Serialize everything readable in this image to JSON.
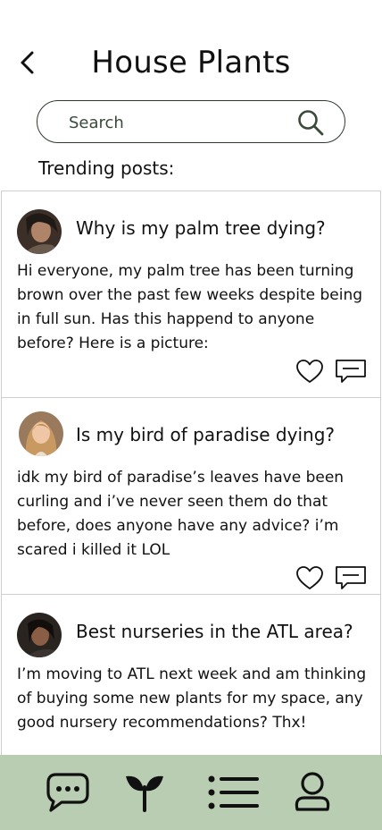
{
  "header": {
    "title": "House Plants"
  },
  "search": {
    "placeholder": "Search",
    "value": ""
  },
  "section": {
    "label": "Trending posts:"
  },
  "posts": [
    {
      "title": "Why is my palm tree dying?",
      "body": "Hi everyone,  my palm tree has been turning brown over the past few weeks despite being in full sun. Has this happend to anyone before? Here is a picture:"
    },
    {
      "title": "Is my bird of paradise dying?",
      "body": "idk my bird of paradise’s leaves have been curling and i’ve never seen them do that before, does anyone have any advice? i’m scared i killed it LOL"
    },
    {
      "title": "Best nurseries in the ATL area?",
      "body": "I’m moving to ATL next week and am thinking of buying some new plants for my space, any good nursery recommendations? Thx!"
    }
  ],
  "nav": {
    "items": [
      {
        "icon": "chat-bubble-icon"
      },
      {
        "icon": "sprout-icon"
      },
      {
        "icon": "list-icon"
      },
      {
        "icon": "profile-icon"
      }
    ]
  },
  "colors": {
    "nav_bg": "#b9cdb3",
    "accent": "#2f3a2f"
  }
}
